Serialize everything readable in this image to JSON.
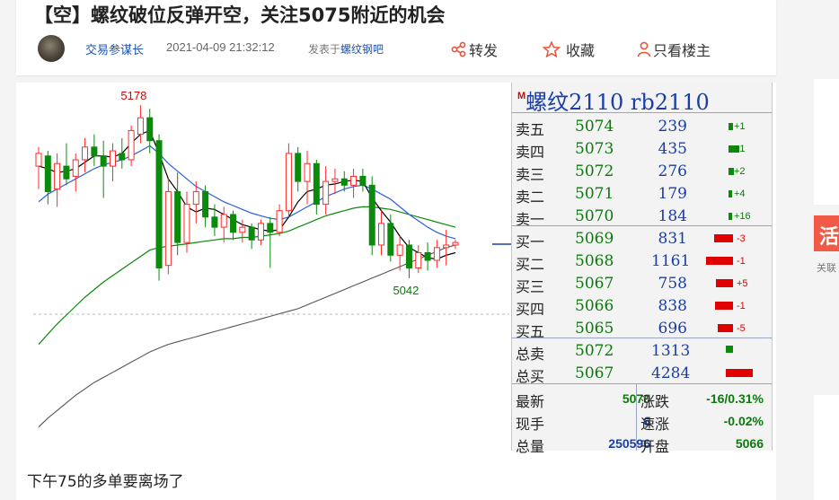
{
  "post": {
    "title": "【空】螺纹破位反弹开空，关注5075附近的机会",
    "author": "交易参谋长",
    "timestamp": "2021-04-09 21:32:12",
    "posted_in_label": "发表于",
    "forum": "螺纹钢吧",
    "body": "下午75的多单要离场了"
  },
  "actions": {
    "share_label": "转发",
    "favorite_label": "收藏",
    "only_op_label": "只看楼主"
  },
  "quote": {
    "marker": "M",
    "title": "螺纹2110  rb2110",
    "asks": [
      {
        "label": "卖五",
        "price": "5074",
        "vol": "239",
        "chg": "+1",
        "bar": 0.15
      },
      {
        "label": "卖四",
        "price": "5073",
        "vol": "435",
        "chg": "+1",
        "bar": 0.4
      },
      {
        "label": "卖三",
        "price": "5072",
        "vol": "276",
        "chg": "+2",
        "bar": 0.2
      },
      {
        "label": "卖二",
        "price": "5071",
        "vol": "179",
        "chg": "+4",
        "bar": 0.12
      },
      {
        "label": "卖一",
        "price": "5070",
        "vol": "184",
        "chg": "+16",
        "bar": 0.12
      }
    ],
    "bids": [
      {
        "label": "买一",
        "price": "5069",
        "vol": "831",
        "chg": "-3",
        "bar": 0.7
      },
      {
        "label": "买二",
        "price": "5068",
        "vol": "1161",
        "chg": "-1",
        "bar": 1.0
      },
      {
        "label": "买三",
        "price": "5067",
        "vol": "758",
        "chg": "+5",
        "bar": 0.62
      },
      {
        "label": "买四",
        "price": "5066",
        "vol": "838",
        "chg": "-1",
        "bar": 0.68
      },
      {
        "label": "买五",
        "price": "5065",
        "vol": "696",
        "chg": "-5",
        "bar": 0.58
      }
    ],
    "totals": [
      {
        "label": "总卖",
        "price": "5072",
        "vol": "1313",
        "bar": 0.25,
        "color": "green"
      },
      {
        "label": "总买",
        "price": "5067",
        "vol": "4284",
        "bar": 1.0,
        "color": "red"
      }
    ],
    "stats": {
      "latest_label": "最新",
      "latest": "5070",
      "change_label": "涨跌",
      "change": "-16/0.31%",
      "hand_label": "现手",
      "hand": "6",
      "speed_label": "速涨",
      "speed": "-0.02%",
      "volume_label": "总量",
      "volume": "250596",
      "open_label": "开盘",
      "open": "5066"
    }
  },
  "chart_data": {
    "type": "candlestick",
    "annotations": [
      "5178",
      "5042"
    ],
    "candles": [
      {
        "o": 5130,
        "h": 5145,
        "l": 5112,
        "c": 5140
      },
      {
        "o": 5138,
        "h": 5142,
        "l": 5100,
        "c": 5110
      },
      {
        "o": 5112,
        "h": 5140,
        "l": 5098,
        "c": 5132
      },
      {
        "o": 5130,
        "h": 5148,
        "l": 5115,
        "c": 5120
      },
      {
        "o": 5122,
        "h": 5140,
        "l": 5110,
        "c": 5135
      },
      {
        "o": 5135,
        "h": 5152,
        "l": 5125,
        "c": 5145
      },
      {
        "o": 5145,
        "h": 5155,
        "l": 5130,
        "c": 5138
      },
      {
        "o": 5138,
        "h": 5150,
        "l": 5105,
        "c": 5130
      },
      {
        "o": 5130,
        "h": 5148,
        "l": 5118,
        "c": 5142
      },
      {
        "o": 5140,
        "h": 5152,
        "l": 5128,
        "c": 5135
      },
      {
        "o": 5135,
        "h": 5162,
        "l": 5130,
        "c": 5158
      },
      {
        "o": 5155,
        "h": 5178,
        "l": 5148,
        "c": 5168
      },
      {
        "o": 5168,
        "h": 5175,
        "l": 5140,
        "c": 5150
      },
      {
        "o": 5150,
        "h": 5155,
        "l": 5040,
        "c": 5050
      },
      {
        "o": 5052,
        "h": 5120,
        "l": 5045,
        "c": 5110
      },
      {
        "o": 5110,
        "h": 5125,
        "l": 5060,
        "c": 5070
      },
      {
        "o": 5070,
        "h": 5110,
        "l": 5062,
        "c": 5100
      },
      {
        "o": 5100,
        "h": 5118,
        "l": 5085,
        "c": 5110
      },
      {
        "o": 5110,
        "h": 5115,
        "l": 5082,
        "c": 5090
      },
      {
        "o": 5090,
        "h": 5100,
        "l": 5075,
        "c": 5082
      },
      {
        "o": 5082,
        "h": 5098,
        "l": 5070,
        "c": 5092
      },
      {
        "o": 5092,
        "h": 5095,
        "l": 5072,
        "c": 5078
      },
      {
        "o": 5078,
        "h": 5088,
        "l": 5070,
        "c": 5082
      },
      {
        "o": 5082,
        "h": 5085,
        "l": 5065,
        "c": 5072
      },
      {
        "o": 5072,
        "h": 5088,
        "l": 5068,
        "c": 5085
      },
      {
        "o": 5085,
        "h": 5090,
        "l": 5050,
        "c": 5078
      },
      {
        "o": 5078,
        "h": 5100,
        "l": 5075,
        "c": 5095
      },
      {
        "o": 5095,
        "h": 5148,
        "l": 5090,
        "c": 5140
      },
      {
        "o": 5140,
        "h": 5145,
        "l": 5110,
        "c": 5118
      },
      {
        "o": 5118,
        "h": 5142,
        "l": 5100,
        "c": 5132
      },
      {
        "o": 5132,
        "h": 5135,
        "l": 5092,
        "c": 5100
      },
      {
        "o": 5100,
        "h": 5130,
        "l": 5092,
        "c": 5118
      },
      {
        "o": 5118,
        "h": 5128,
        "l": 5108,
        "c": 5120
      },
      {
        "o": 5120,
        "h": 5126,
        "l": 5110,
        "c": 5115
      },
      {
        "o": 5115,
        "h": 5128,
        "l": 5105,
        "c": 5122
      },
      {
        "o": 5122,
        "h": 5128,
        "l": 5110,
        "c": 5115
      },
      {
        "o": 5115,
        "h": 5122,
        "l": 5060,
        "c": 5068
      },
      {
        "o": 5068,
        "h": 5095,
        "l": 5060,
        "c": 5085
      },
      {
        "o": 5085,
        "h": 5092,
        "l": 5055,
        "c": 5060
      },
      {
        "o": 5060,
        "h": 5075,
        "l": 5048,
        "c": 5068
      },
      {
        "o": 5068,
        "h": 5072,
        "l": 5042,
        "c": 5050
      },
      {
        "o": 5050,
        "h": 5068,
        "l": 5046,
        "c": 5062
      },
      {
        "o": 5062,
        "h": 5070,
        "l": 5048,
        "c": 5056
      },
      {
        "o": 5056,
        "h": 5072,
        "l": 5050,
        "c": 5066
      },
      {
        "o": 5066,
        "h": 5080,
        "l": 5052,
        "c": 5068
      },
      {
        "o": 5068,
        "h": 5072,
        "l": 5065,
        "c": 5070
      }
    ],
    "ma_fast": [
      5130,
      5128,
      5125,
      5126,
      5128,
      5133,
      5138,
      5138,
      5137,
      5140,
      5148,
      5155,
      5158,
      5140,
      5120,
      5110,
      5098,
      5094,
      5097,
      5096,
      5092,
      5088,
      5084,
      5082,
      5080,
      5079,
      5080,
      5090,
      5102,
      5110,
      5112,
      5115,
      5116,
      5118,
      5119,
      5118,
      5105,
      5095,
      5086,
      5075,
      5066,
      5062,
      5058,
      5057,
      5060,
      5062
    ],
    "ma_mid": [
      5102,
      5108,
      5112,
      5116,
      5120,
      5124,
      5128,
      5131,
      5133,
      5135,
      5138,
      5142,
      5146,
      5140,
      5132,
      5126,
      5120,
      5114,
      5110,
      5106,
      5102,
      5099,
      5096,
      5093,
      5091,
      5089,
      5088,
      5090,
      5094,
      5098,
      5102,
      5106,
      5109,
      5112,
      5114,
      5115,
      5112,
      5108,
      5104,
      5098,
      5092,
      5087,
      5082,
      5078,
      5075,
      5073
    ],
    "ma_slow": [
      4990,
      4998,
      5006,
      5013,
      5020,
      5027,
      5033,
      5039,
      5044,
      5049,
      5054,
      5059,
      5064,
      5066,
      5067,
      5068,
      5069,
      5070,
      5071,
      5072,
      5073,
      5073,
      5074,
      5074,
      5075,
      5076,
      5077,
      5079,
      5082,
      5085,
      5088,
      5091,
      5093,
      5095,
      5097,
      5098,
      5098,
      5097,
      5096,
      5094,
      5092,
      5090,
      5088,
      5086,
      5084,
      5082
    ],
    "ma_long": [
      4925,
      4932,
      4938,
      4944,
      4950,
      4955,
      4960,
      4964,
      4968,
      4972,
      4976,
      4980,
      4984,
      4987,
      4990,
      4992,
      4994,
      4996,
      4998,
      5000,
      5002,
      5004,
      5006,
      5008,
      5010,
      5012,
      5014,
      5016,
      5018,
      5021,
      5024,
      5027,
      5030,
      5033,
      5036,
      5039,
      5042,
      5045,
      5048,
      5051,
      5054,
      5057,
      5060,
      5063,
      5066,
      5068
    ],
    "ylim": [
      4910,
      5190
    ],
    "colors": {
      "up": "#ff2a2a",
      "down": "#0b8a0b",
      "ma_fast": "#000000",
      "ma_mid": "#2a5fe0",
      "ma_slow": "#0a8a0a",
      "ma_long": "#555555"
    }
  }
}
